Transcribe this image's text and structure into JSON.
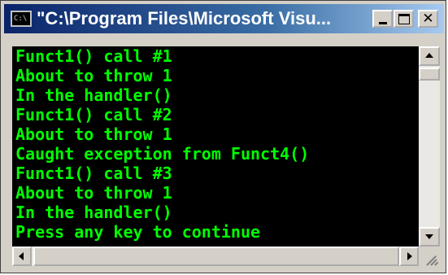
{
  "window": {
    "title": "\"C:\\Program Files\\Microsoft Visu...",
    "icon": "console-app-icon",
    "icon_label": "C:\\"
  },
  "caption_buttons": {
    "minimize_icon": "minimize-icon",
    "maximize_icon": "maximize-icon",
    "close_icon": "close-icon",
    "close_glyph": "✕"
  },
  "console": {
    "foreground_color": "#00ff00",
    "background_color": "#000000",
    "lines": [
      "Funct1() call #1",
      "About to throw 1",
      "In the handler()",
      "Funct1() call #2",
      "About to throw 1",
      "Caught exception from Funct4()",
      "Funct1() call #3",
      "About to throw 1",
      "In the handler()",
      "Press any key to continue"
    ]
  },
  "scrollbars": {
    "vertical_up_icon": "arrow-up-icon",
    "vertical_down_icon": "arrow-down-icon",
    "horizontal_left_icon": "arrow-left-icon",
    "horizontal_right_icon": "arrow-right-icon"
  },
  "colors": {
    "titlebar_start": "#0a246a",
    "titlebar_end": "#a6caf0",
    "chrome": "#d4d0c8"
  }
}
